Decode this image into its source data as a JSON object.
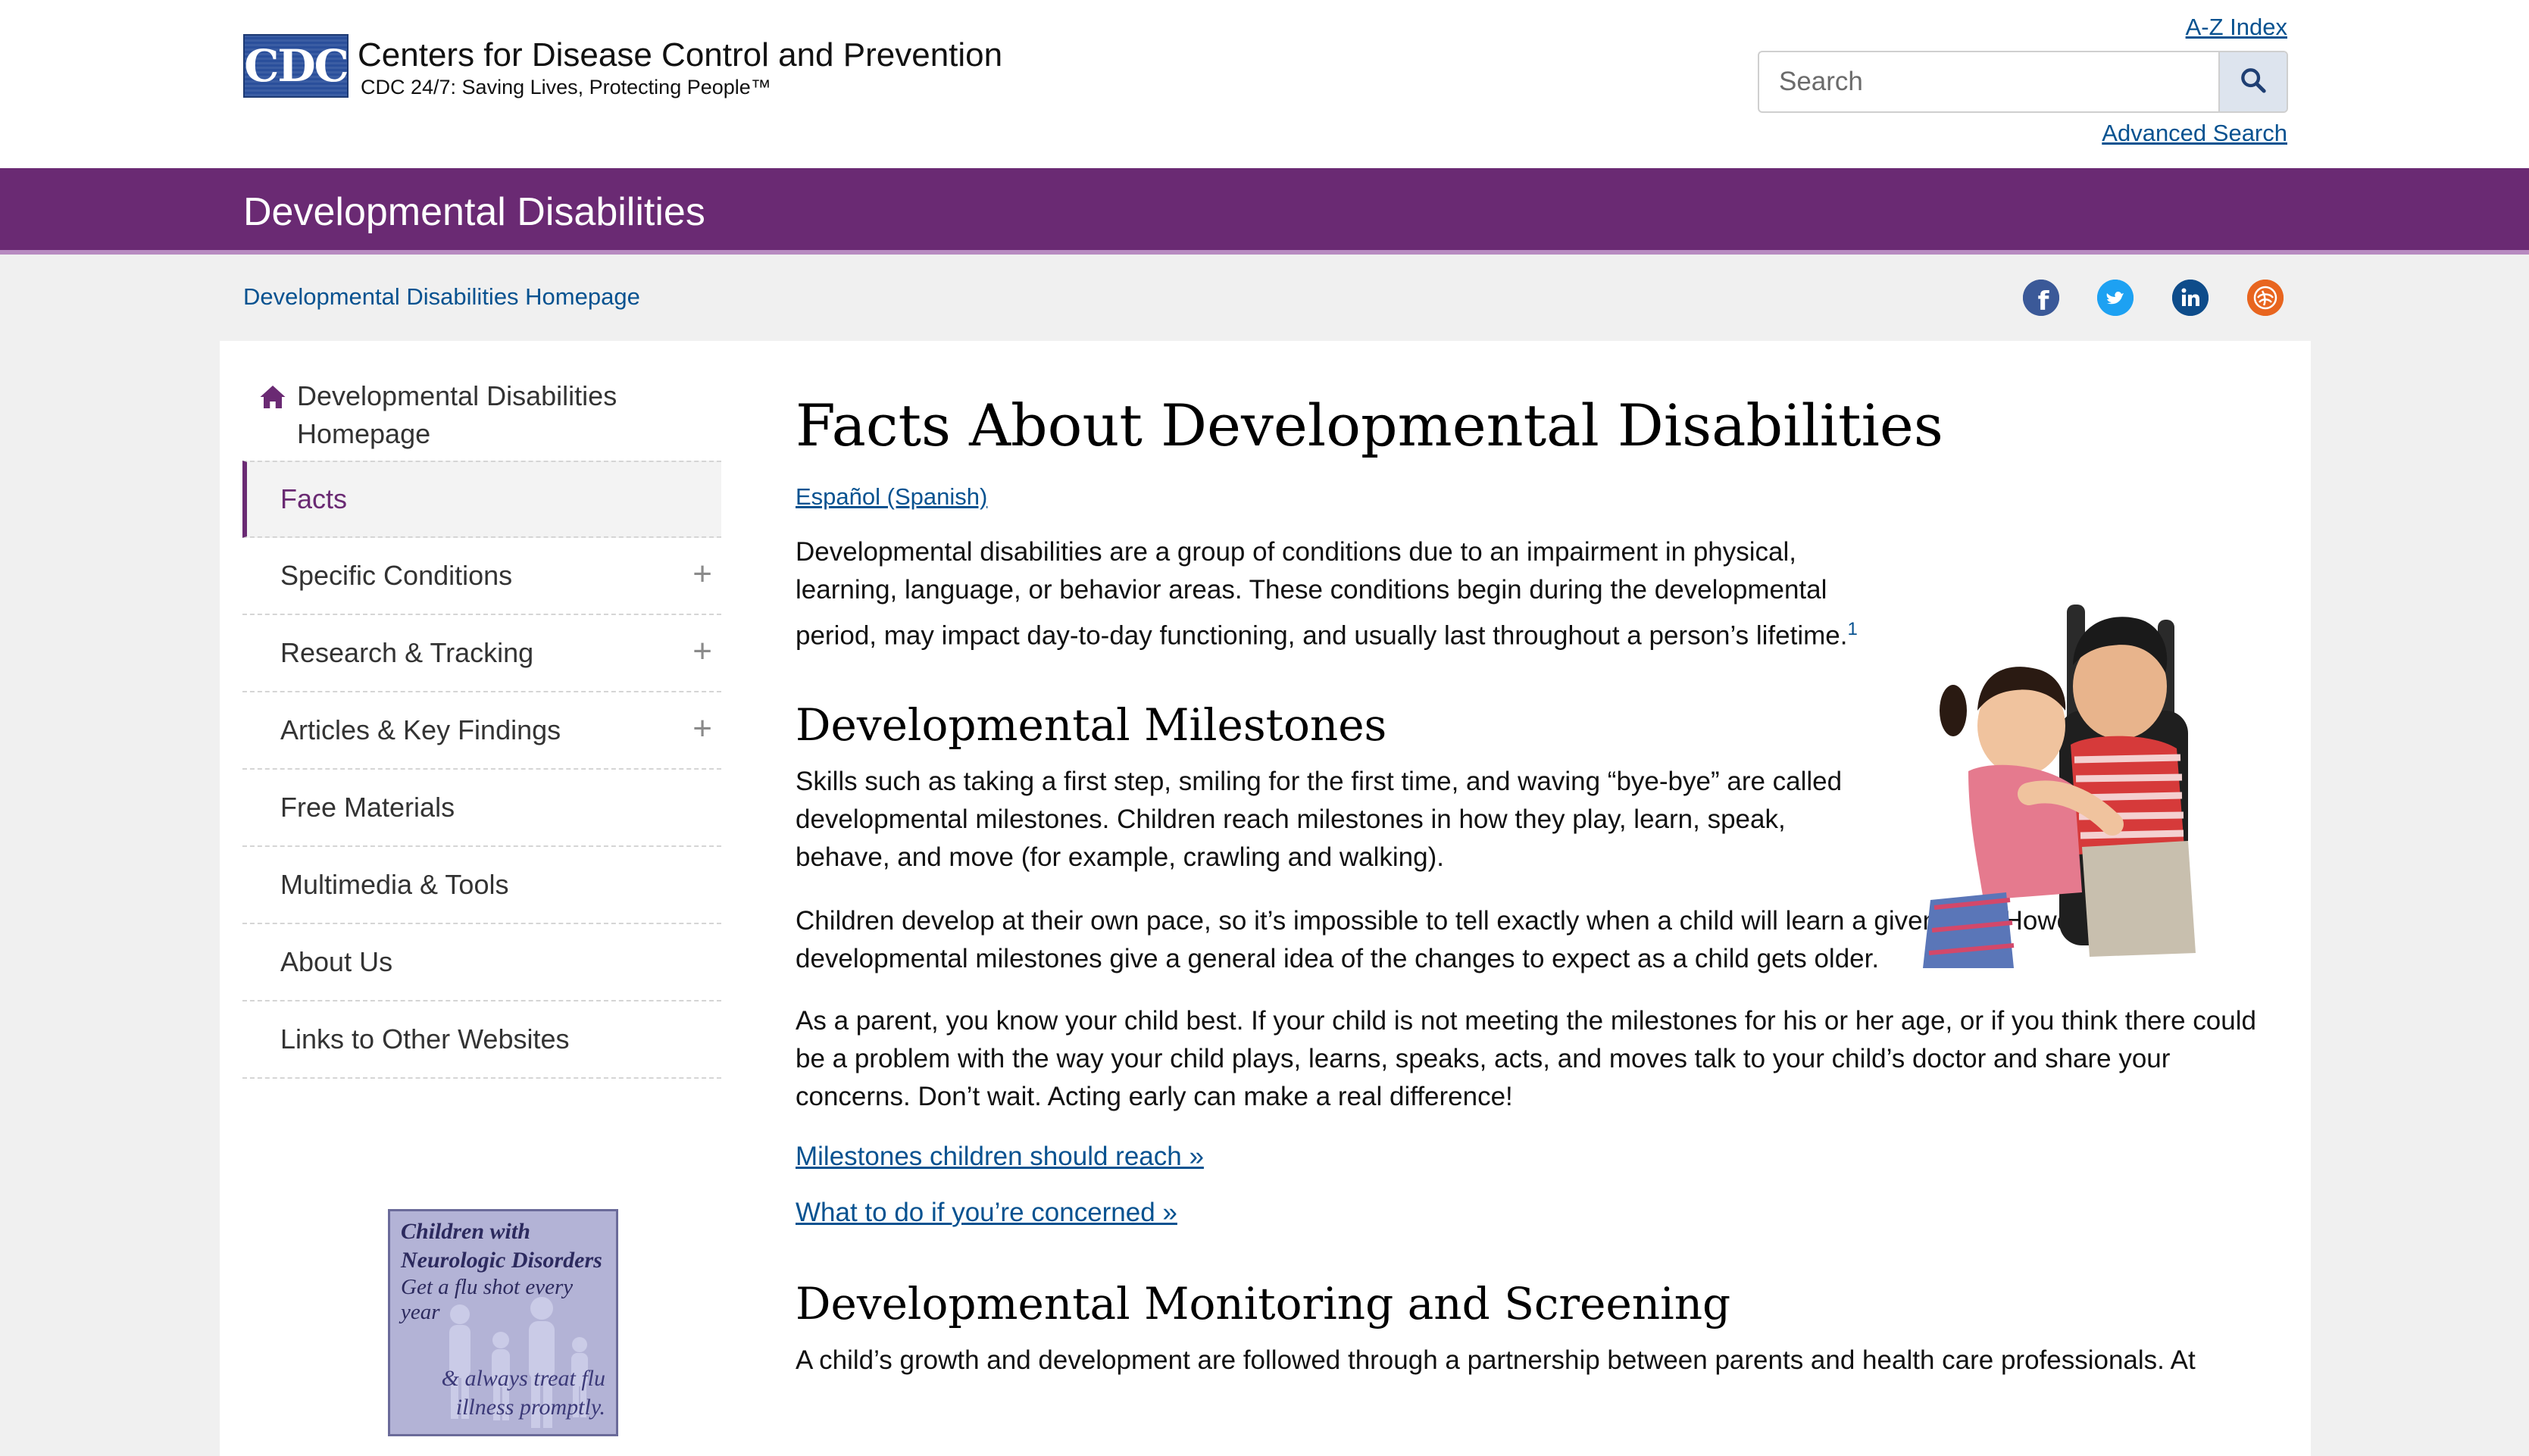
{
  "header": {
    "logo_text": "CDC",
    "org_name": "Centers for Disease Control and Prevention",
    "tagline": "CDC 24/7: Saving Lives, Protecting People™",
    "az_index": "A-Z Index",
    "search_placeholder": "Search",
    "advanced_search": "Advanced Search"
  },
  "site_bar": {
    "title": "Developmental Disabilities"
  },
  "breadcrumb": {
    "home": "Developmental Disabilities Homepage"
  },
  "social": {
    "icons": [
      "facebook-icon",
      "twitter-icon",
      "linkedin-icon",
      "syndicate-icon"
    ],
    "colors": {
      "facebook": "#3b5998",
      "twitter": "#1da1f2",
      "linkedin": "#0e4c8a",
      "syndicate": "#e8651f"
    }
  },
  "sidebar": {
    "home_label": "Developmental Disabilities Homepage",
    "items": [
      {
        "label": "Facts",
        "active": true,
        "expandable": false
      },
      {
        "label": "Specific Conditions",
        "active": false,
        "expandable": true
      },
      {
        "label": "Research & Tracking",
        "active": false,
        "expandable": true
      },
      {
        "label": "Articles & Key Findings",
        "active": false,
        "expandable": true
      },
      {
        "label": "Free Materials",
        "active": false,
        "expandable": false
      },
      {
        "label": "Multimedia & Tools",
        "active": false,
        "expandable": false
      },
      {
        "label": "About Us",
        "active": false,
        "expandable": false
      },
      {
        "label": "Links to Other Websites",
        "active": false,
        "expandable": false
      }
    ],
    "expand_symbol": "+",
    "badge": {
      "line1": "Children with",
      "line2": "Neurologic Disorders",
      "line3": "Get a flu shot every year",
      "line4": "& always treat flu",
      "line5": "illness promptly."
    }
  },
  "main": {
    "title": "Facts About Developmental Disabilities",
    "language_link": "Español (Spanish)",
    "intro": "Developmental disabilities are a group of conditions due to an impairment in physical, learning, language, or behavior areas. These conditions begin during the developmental period, may impact day-to-day functioning, and usually last throughout a person’s lifetime.",
    "intro_footnote": "1",
    "milestones_heading": "Developmental Milestones",
    "milestones_p1": "Skills such as taking a first step, smiling for the first time, and waving “bye-bye” are called developmental milestones. Children reach milestones in how they play, learn, speak, behave, and move (for example, crawling and walking).",
    "milestones_p2": "Children develop at their own pace, so it’s impossible to tell exactly when a child will learn a given skill. However, the developmental milestones give a general idea of the changes to expect as a child gets older.",
    "milestones_p3": "As a parent, you know your child best. If your child is not meeting the milestones for his or her age, or if you think there could be a problem with the way your child plays, learns, speaks, acts, and moves talk to your child’s doctor and share your concerns. Don’t wait. Acting early can make a real difference!",
    "link_milestones": "Milestones children should reach »",
    "link_concerned": "What to do if you’re concerned »",
    "monitoring_heading": "Developmental Monitoring and Screening",
    "monitoring_p1": "A child’s growth and development are followed through a partnership between parents and health care professionals. At"
  },
  "colors": {
    "brand_purple": "#6a2a73",
    "link_blue": "#075290",
    "page_bg": "#f0f0f0"
  }
}
